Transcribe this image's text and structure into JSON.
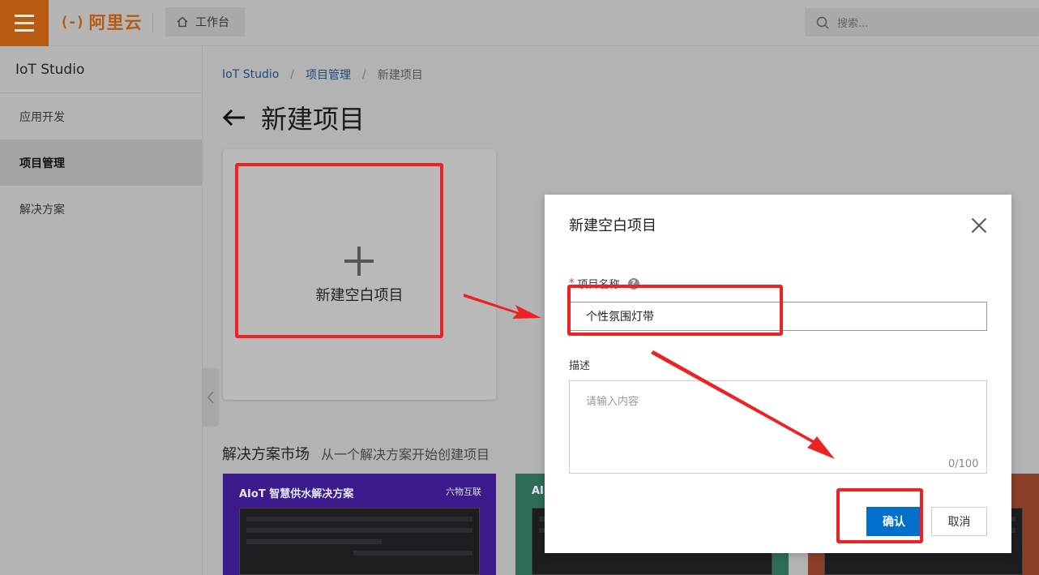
{
  "topbar": {
    "logo_mark": "(-)",
    "logo_text": "阿里云",
    "workbench_label": "工作台",
    "search_placeholder": "搜索..."
  },
  "sidebar": {
    "title": "IoT Studio",
    "items": [
      {
        "label": "应用开发",
        "active": false
      },
      {
        "label": "项目管理",
        "active": true
      },
      {
        "label": "解决方案",
        "active": false
      }
    ]
  },
  "breadcrumb": {
    "items": [
      "IoT Studio",
      "项目管理",
      "新建项目"
    ],
    "separator": "/"
  },
  "page": {
    "title": "新建项目",
    "blank_card_label": "新建空白项目"
  },
  "market": {
    "title": "解决方案市场",
    "subtitle": "从一个解决方案开始创建项目",
    "cards": [
      {
        "title": "AIoT 智慧供水解决方案",
        "brand": "六物互联"
      },
      {
        "title": "AI",
        "brand": ""
      },
      {
        "title": "",
        "brand": ""
      }
    ]
  },
  "modal": {
    "title": "新建空白项目",
    "name_label": "项目名称",
    "name_required_mark": "*",
    "help_mark": "?",
    "name_value": "个性氛围灯带",
    "desc_label": "描述",
    "desc_placeholder": "请输入内容",
    "desc_counter": "0/100",
    "confirm_label": "确认",
    "cancel_label": "取消"
  },
  "colors": {
    "annotation_red": "#ee2222",
    "primary_blue": "#0070cc",
    "brand_orange": "#b75a12"
  }
}
